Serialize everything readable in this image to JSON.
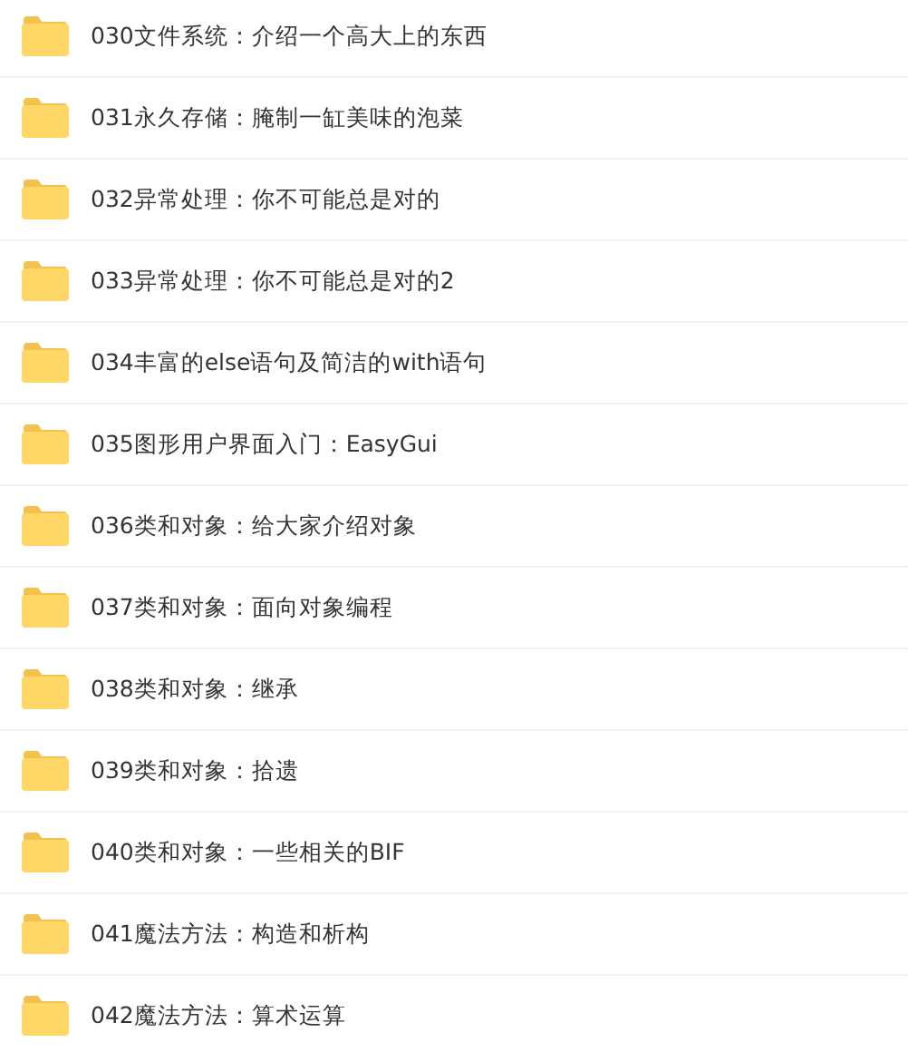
{
  "folders": [
    {
      "name": "030文件系统：介绍一个高大上的东西"
    },
    {
      "name": "031永久存储：腌制一缸美味的泡菜"
    },
    {
      "name": "032异常处理：你不可能总是对的"
    },
    {
      "name": "033异常处理：你不可能总是对的2"
    },
    {
      "name": "034丰富的else语句及简洁的with语句"
    },
    {
      "name": "035图形用户界面入门：EasyGui"
    },
    {
      "name": "036类和对象：给大家介绍对象"
    },
    {
      "name": "037类和对象：面向对象编程"
    },
    {
      "name": "038类和对象：继承"
    },
    {
      "name": "039类和对象：拾遗"
    },
    {
      "name": "040类和对象：一些相关的BIF"
    },
    {
      "name": "041魔法方法：构造和析构"
    },
    {
      "name": "042魔法方法：算术运算"
    }
  ]
}
